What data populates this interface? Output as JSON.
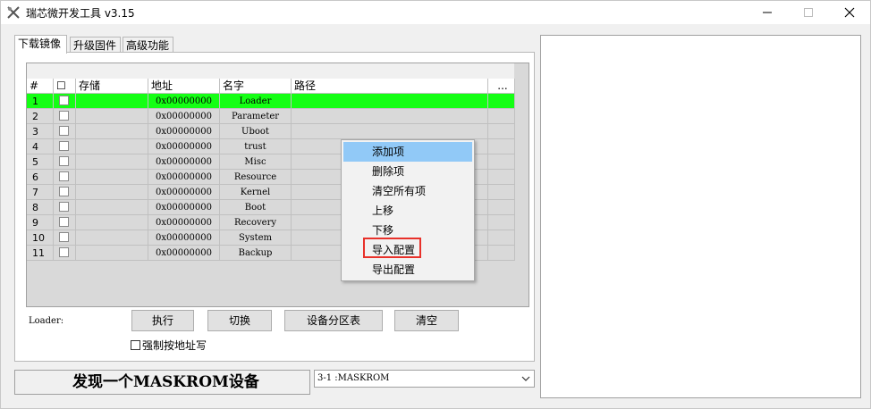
{
  "window": {
    "title": "瑞芯微开发工具 v3.15",
    "minimize": "—",
    "maximize": "☐",
    "close": "✕"
  },
  "tabs": [
    {
      "label": "下载镜像",
      "active": true
    },
    {
      "label": "升级固件",
      "active": false
    },
    {
      "label": "高级功能",
      "active": false
    }
  ],
  "table": {
    "headers": {
      "num": "#",
      "check": "☐",
      "storage": "存储",
      "address": "地址",
      "name": "名字",
      "path": "路径",
      "more": "..."
    },
    "rows": [
      {
        "num": "1",
        "address": "0x00000000",
        "name": "Loader",
        "highlight": true
      },
      {
        "num": "2",
        "address": "0x00000000",
        "name": "Parameter"
      },
      {
        "num": "3",
        "address": "0x00000000",
        "name": "Uboot"
      },
      {
        "num": "4",
        "address": "0x00000000",
        "name": "trust"
      },
      {
        "num": "5",
        "address": "0x00000000",
        "name": "Misc"
      },
      {
        "num": "6",
        "address": "0x00000000",
        "name": "Resource"
      },
      {
        "num": "7",
        "address": "0x00000000",
        "name": "Kernel"
      },
      {
        "num": "8",
        "address": "0x00000000",
        "name": "Boot"
      },
      {
        "num": "9",
        "address": "0x00000000",
        "name": "Recovery"
      },
      {
        "num": "10",
        "address": "0x00000000",
        "name": "System"
      },
      {
        "num": "11",
        "address": "0x00000000",
        "name": "Backup"
      }
    ],
    "highlight_color": "#14ff14"
  },
  "controls": {
    "loader_label": "Loader:",
    "run": "执行",
    "switch": "切换",
    "partition_table": "设备分区表",
    "clear": "清空",
    "force_address": "强制按地址写"
  },
  "status": {
    "message": "发现一个MASKROM设备",
    "device": "3-1 :MASKROM"
  },
  "context_menu": {
    "items": [
      "添加项",
      "删除项",
      "清空所有项",
      "上移",
      "下移",
      "导入配置",
      "导出配置"
    ],
    "hovered": "添加项",
    "outlined": "导入配置",
    "hover_color": "#91c9f7",
    "outline_color": "#e8312a"
  }
}
